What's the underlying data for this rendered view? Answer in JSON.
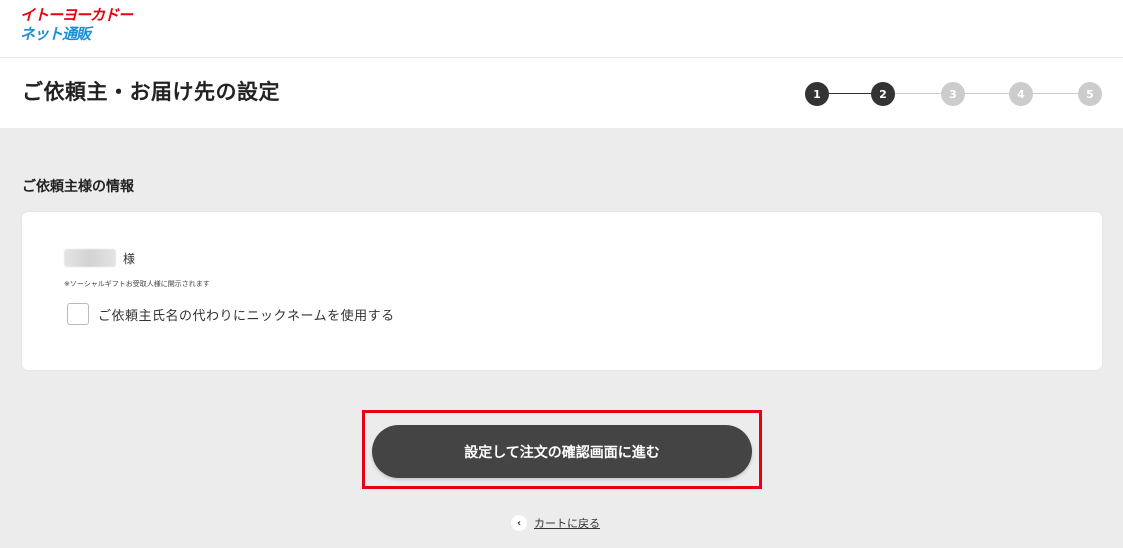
{
  "logo": {
    "line1": "イトーヨーカドー",
    "line2": "ネット通販"
  },
  "page": {
    "title": "ご依頼主・お届け先の設定"
  },
  "stepper": {
    "steps": [
      "1",
      "2",
      "3",
      "4",
      "5"
    ],
    "current": 2
  },
  "requester": {
    "heading": "ご依頼主様の情報",
    "honorific": "様",
    "note": "※ソーシャルギフトお受取人様に開示されます",
    "nickname_checkbox": {
      "label": "ご依頼主氏名の代わりにニックネームを使用する",
      "checked": false
    }
  },
  "actions": {
    "submit_label": "設定して注文の確認画面に進む",
    "back_label": "カートに戻る",
    "back_icon": "chevron-left-icon"
  },
  "colors": {
    "accent_red": "#e60012",
    "brand_blue": "#1b8fd6",
    "button": "#444444"
  }
}
